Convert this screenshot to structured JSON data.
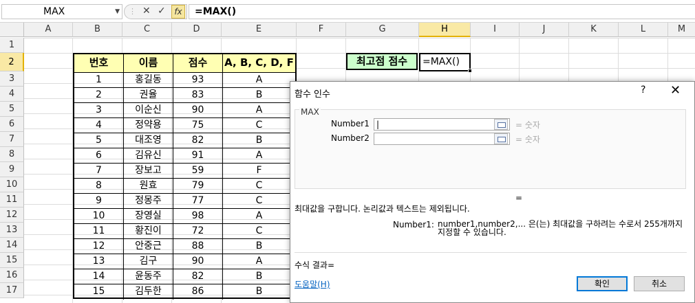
{
  "formula_bar": {
    "name_box": "MAX",
    "formula": "=MAX()",
    "cancel_glyph": "✕",
    "enter_glyph": "✓",
    "fx_label": "fx"
  },
  "columns": [
    "A",
    "B",
    "C",
    "D",
    "E",
    "F",
    "G",
    "H",
    "I",
    "J",
    "K",
    "L",
    "M"
  ],
  "rows": [
    "1",
    "2",
    "3",
    "4",
    "5",
    "6",
    "7",
    "8",
    "9",
    "10",
    "11",
    "12",
    "13",
    "14",
    "15",
    "16",
    "17"
  ],
  "table": {
    "headers": [
      "번호",
      "이름",
      "점수",
      "A, B, C, D, F"
    ],
    "rows": [
      [
        "1",
        "홍길동",
        "93",
        "A"
      ],
      [
        "2",
        "권율",
        "83",
        "B"
      ],
      [
        "3",
        "이순신",
        "90",
        "A"
      ],
      [
        "4",
        "정약용",
        "75",
        "C"
      ],
      [
        "5",
        "대조영",
        "82",
        "B"
      ],
      [
        "6",
        "김유신",
        "91",
        "A"
      ],
      [
        "7",
        "장보고",
        "59",
        "F"
      ],
      [
        "8",
        "원효",
        "79",
        "C"
      ],
      [
        "9",
        "정몽주",
        "77",
        "C"
      ],
      [
        "10",
        "장영실",
        "98",
        "A"
      ],
      [
        "11",
        "황진이",
        "72",
        "C"
      ],
      [
        "12",
        "안중근",
        "88",
        "B"
      ],
      [
        "13",
        "김구",
        "90",
        "A"
      ],
      [
        "14",
        "윤동주",
        "82",
        "B"
      ],
      [
        "15",
        "김두한",
        "86",
        "B"
      ]
    ]
  },
  "g2_label": "최고점 점수",
  "h2_value": "=MAX()",
  "dialog": {
    "title": "함수 인수",
    "help_glyph": "?",
    "close_glyph": "✕",
    "function_name": "MAX",
    "args": [
      {
        "label": "Number1",
        "value": "|",
        "result": "=  숫자"
      },
      {
        "label": "Number2",
        "value": "",
        "result": "=  숫자"
      }
    ],
    "equals": "=",
    "description": "최대값을 구합니다. 논리값과 텍스트는 제외됩니다.",
    "arg_name": "Number1:",
    "arg_description": "number1,number2,... 은(는) 최대값을 구하려는 수로서 255개까지 지정할 수 있습니다.",
    "formula_result": "수식 결과=",
    "help_link": "도움말(H)",
    "ok_label": "확인",
    "cancel_label": "취소"
  }
}
